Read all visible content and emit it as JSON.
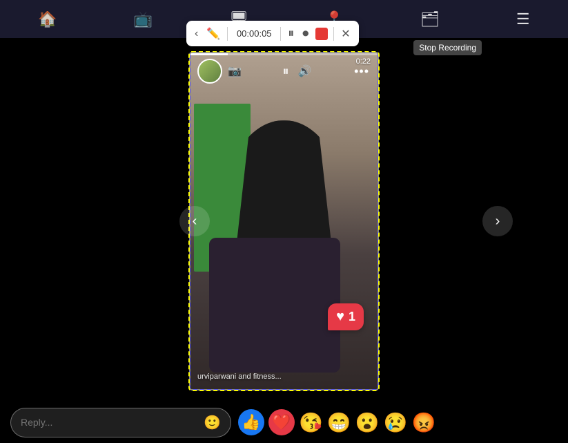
{
  "topbar": {
    "icons": [
      "home",
      "tv",
      "monitor",
      "location",
      "layers",
      "menu"
    ]
  },
  "recording": {
    "timer": "00:00:05",
    "stop_tooltip": "Stop Recording"
  },
  "story": {
    "username": "urviparwani and fitness...",
    "timestamp": "0:22",
    "like_count": "1"
  },
  "bottom": {
    "reply_placeholder": "Reply...",
    "reactions": [
      "👍",
      "❤️",
      "😘",
      "😁",
      "😮",
      "😢",
      "😡"
    ]
  }
}
